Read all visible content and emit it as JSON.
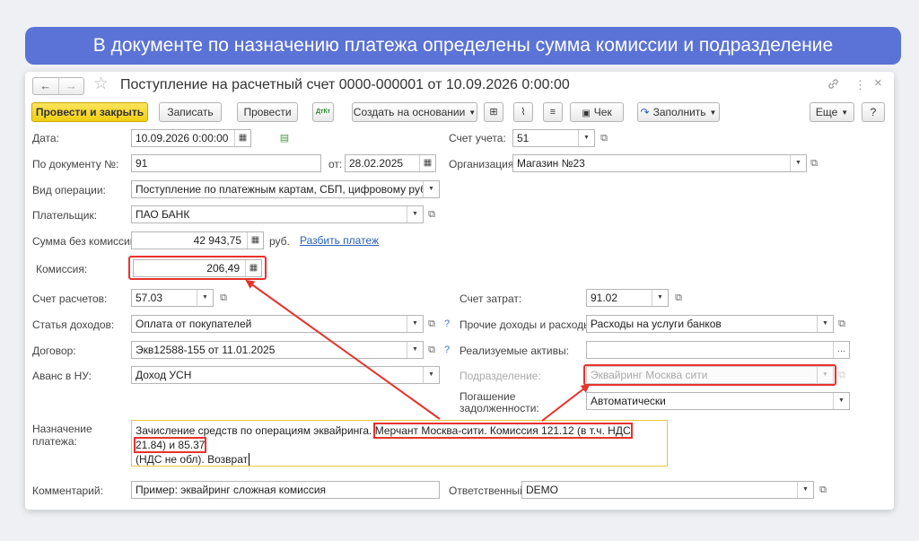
{
  "banner": "В документе по назначению платежа определены сумма комиссии и подразделение",
  "window": {
    "title": "Поступление на расчетный счет 0000-000001 от 10.09.2026 0:00:00",
    "nav_back": "←",
    "nav_forward": "→",
    "star": "☆",
    "link_icon": "🔗",
    "more_icon": "⋮",
    "close_icon": "×"
  },
  "toolbar": {
    "post_close": "Провести и закрыть",
    "save": "Записать",
    "post": "Провести",
    "dtkt": "ДтКт",
    "create_based": "Создать на основании",
    "receipt": "Чек",
    "fill": "Заполнить",
    "more": "Еще",
    "help": "?"
  },
  "form": {
    "date_label": "Дата:",
    "date_value": "10.09.2026  0:00:00",
    "account_label": "Счет учета:",
    "account_value": "51",
    "doc_label": "По документу №:",
    "doc_value": "91",
    "from_label": "от:",
    "from_value": "28.02.2025",
    "org_label": "Организация:",
    "org_value": "Магазин №23",
    "op_label": "Вид операции:",
    "op_value": "Поступление по платежным картам, СБП, цифровому рублю",
    "payer_label": "Плательщик:",
    "payer_value": "ПАО БАНК",
    "sum_label": "Сумма без комиссии:",
    "sum_value": "42 943,75",
    "rub": "руб.",
    "split_link": "Разбить платеж",
    "commission_label": "Комиссия:",
    "commission_value": "206,49",
    "settle_label": "Счет расчетов:",
    "settle_value": "57.03",
    "cost_label": "Счет затрат:",
    "cost_value": "91.02",
    "income_label": "Статья доходов:",
    "income_value": "Оплата от покупателей",
    "other_label": "Прочие доходы и расходы:",
    "other_value": "Расходы на услуги банков",
    "contract_label": "Договор:",
    "contract_value": "Экв12588-155 от 11.01.2025",
    "assets_label": "Реализуемые активы:",
    "assets_value": "",
    "advance_label": "Аванс в НУ:",
    "advance_value": "Доход УСН",
    "division_label": "Подразделение:",
    "division_value": "Эквайринг Москва сити",
    "repay_label_1": "Погашение",
    "repay_label_2": "задолженности:",
    "repay_value": "Автоматически",
    "purpose_label_1": "Назначение",
    "purpose_label_2": "платежа:",
    "purpose_text_a": "Зачисление средств по операциям эквайринга.",
    "purpose_text_b": "Мерчант Москва-сити. Комиссия 121.12 (в т.ч. НДС 21.84) и 85.37",
    "purpose_text_c": "(НДС не обл). Возврат",
    "comment_label": "Комментарий:",
    "comment_value": "Пример: эквайринг сложная комиссия",
    "resp_label": "Ответственный:",
    "resp_value": "DEMO"
  },
  "colors": {
    "banner": "#5b73d6",
    "highlight": "#e8322c",
    "primary_button": "#f2cf12"
  }
}
